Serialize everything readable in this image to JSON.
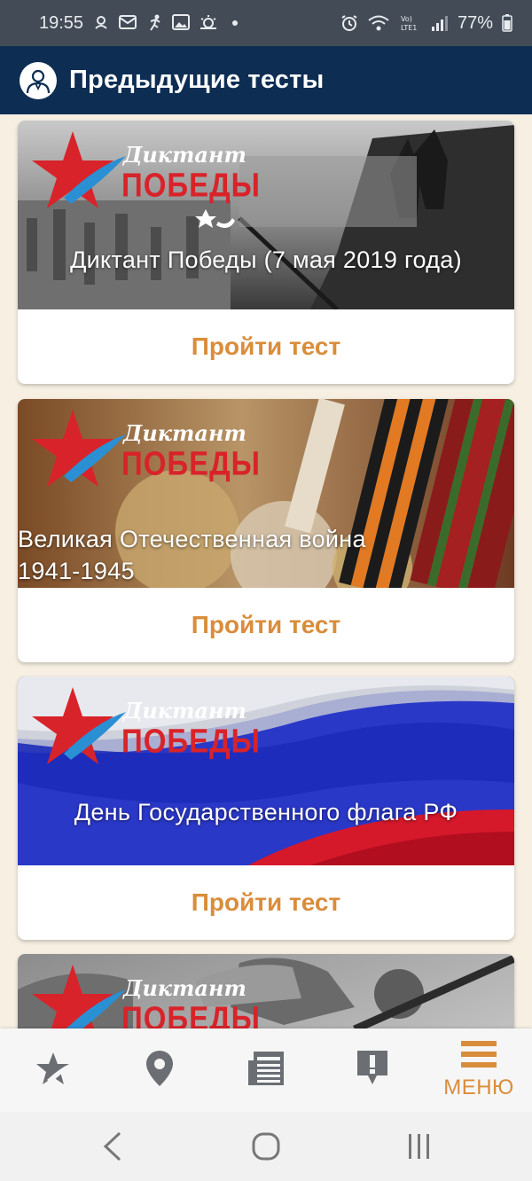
{
  "status_bar": {
    "time": "19:55",
    "battery": "77%",
    "left_icons": [
      "notification-icon",
      "mail-icon",
      "running-icon",
      "image-icon",
      "weather-icon"
    ],
    "right_icons": [
      "alarm-icon",
      "wifi-icon",
      "volte-icon",
      "signal-icon",
      "battery-icon"
    ]
  },
  "app_bar": {
    "title": "Предыдущие тесты"
  },
  "logo": {
    "word_top": "Диктант",
    "word_bottom": "ПОБЕДЫ"
  },
  "cards": [
    {
      "title": "Диктант Победы (7 мая 2019 года)",
      "action": "Пройти тест"
    },
    {
      "title": "Великая Отечественная война 1941-1945",
      "action": "Пройти тест"
    },
    {
      "title": "День Государственного флага РФ",
      "action": "Пройти тест"
    },
    {
      "title": "",
      "action": ""
    }
  ],
  "bottom_nav": {
    "items": [
      "star-icon",
      "location-pin-icon",
      "news-icon",
      "alert-icon",
      "menu-icon"
    ],
    "menu_label": "МЕНЮ"
  },
  "colors": {
    "app_bar": "#0d2d52",
    "accent": "#d98d3b",
    "background": "#f6efe2",
    "logo_red": "#d8232a"
  }
}
